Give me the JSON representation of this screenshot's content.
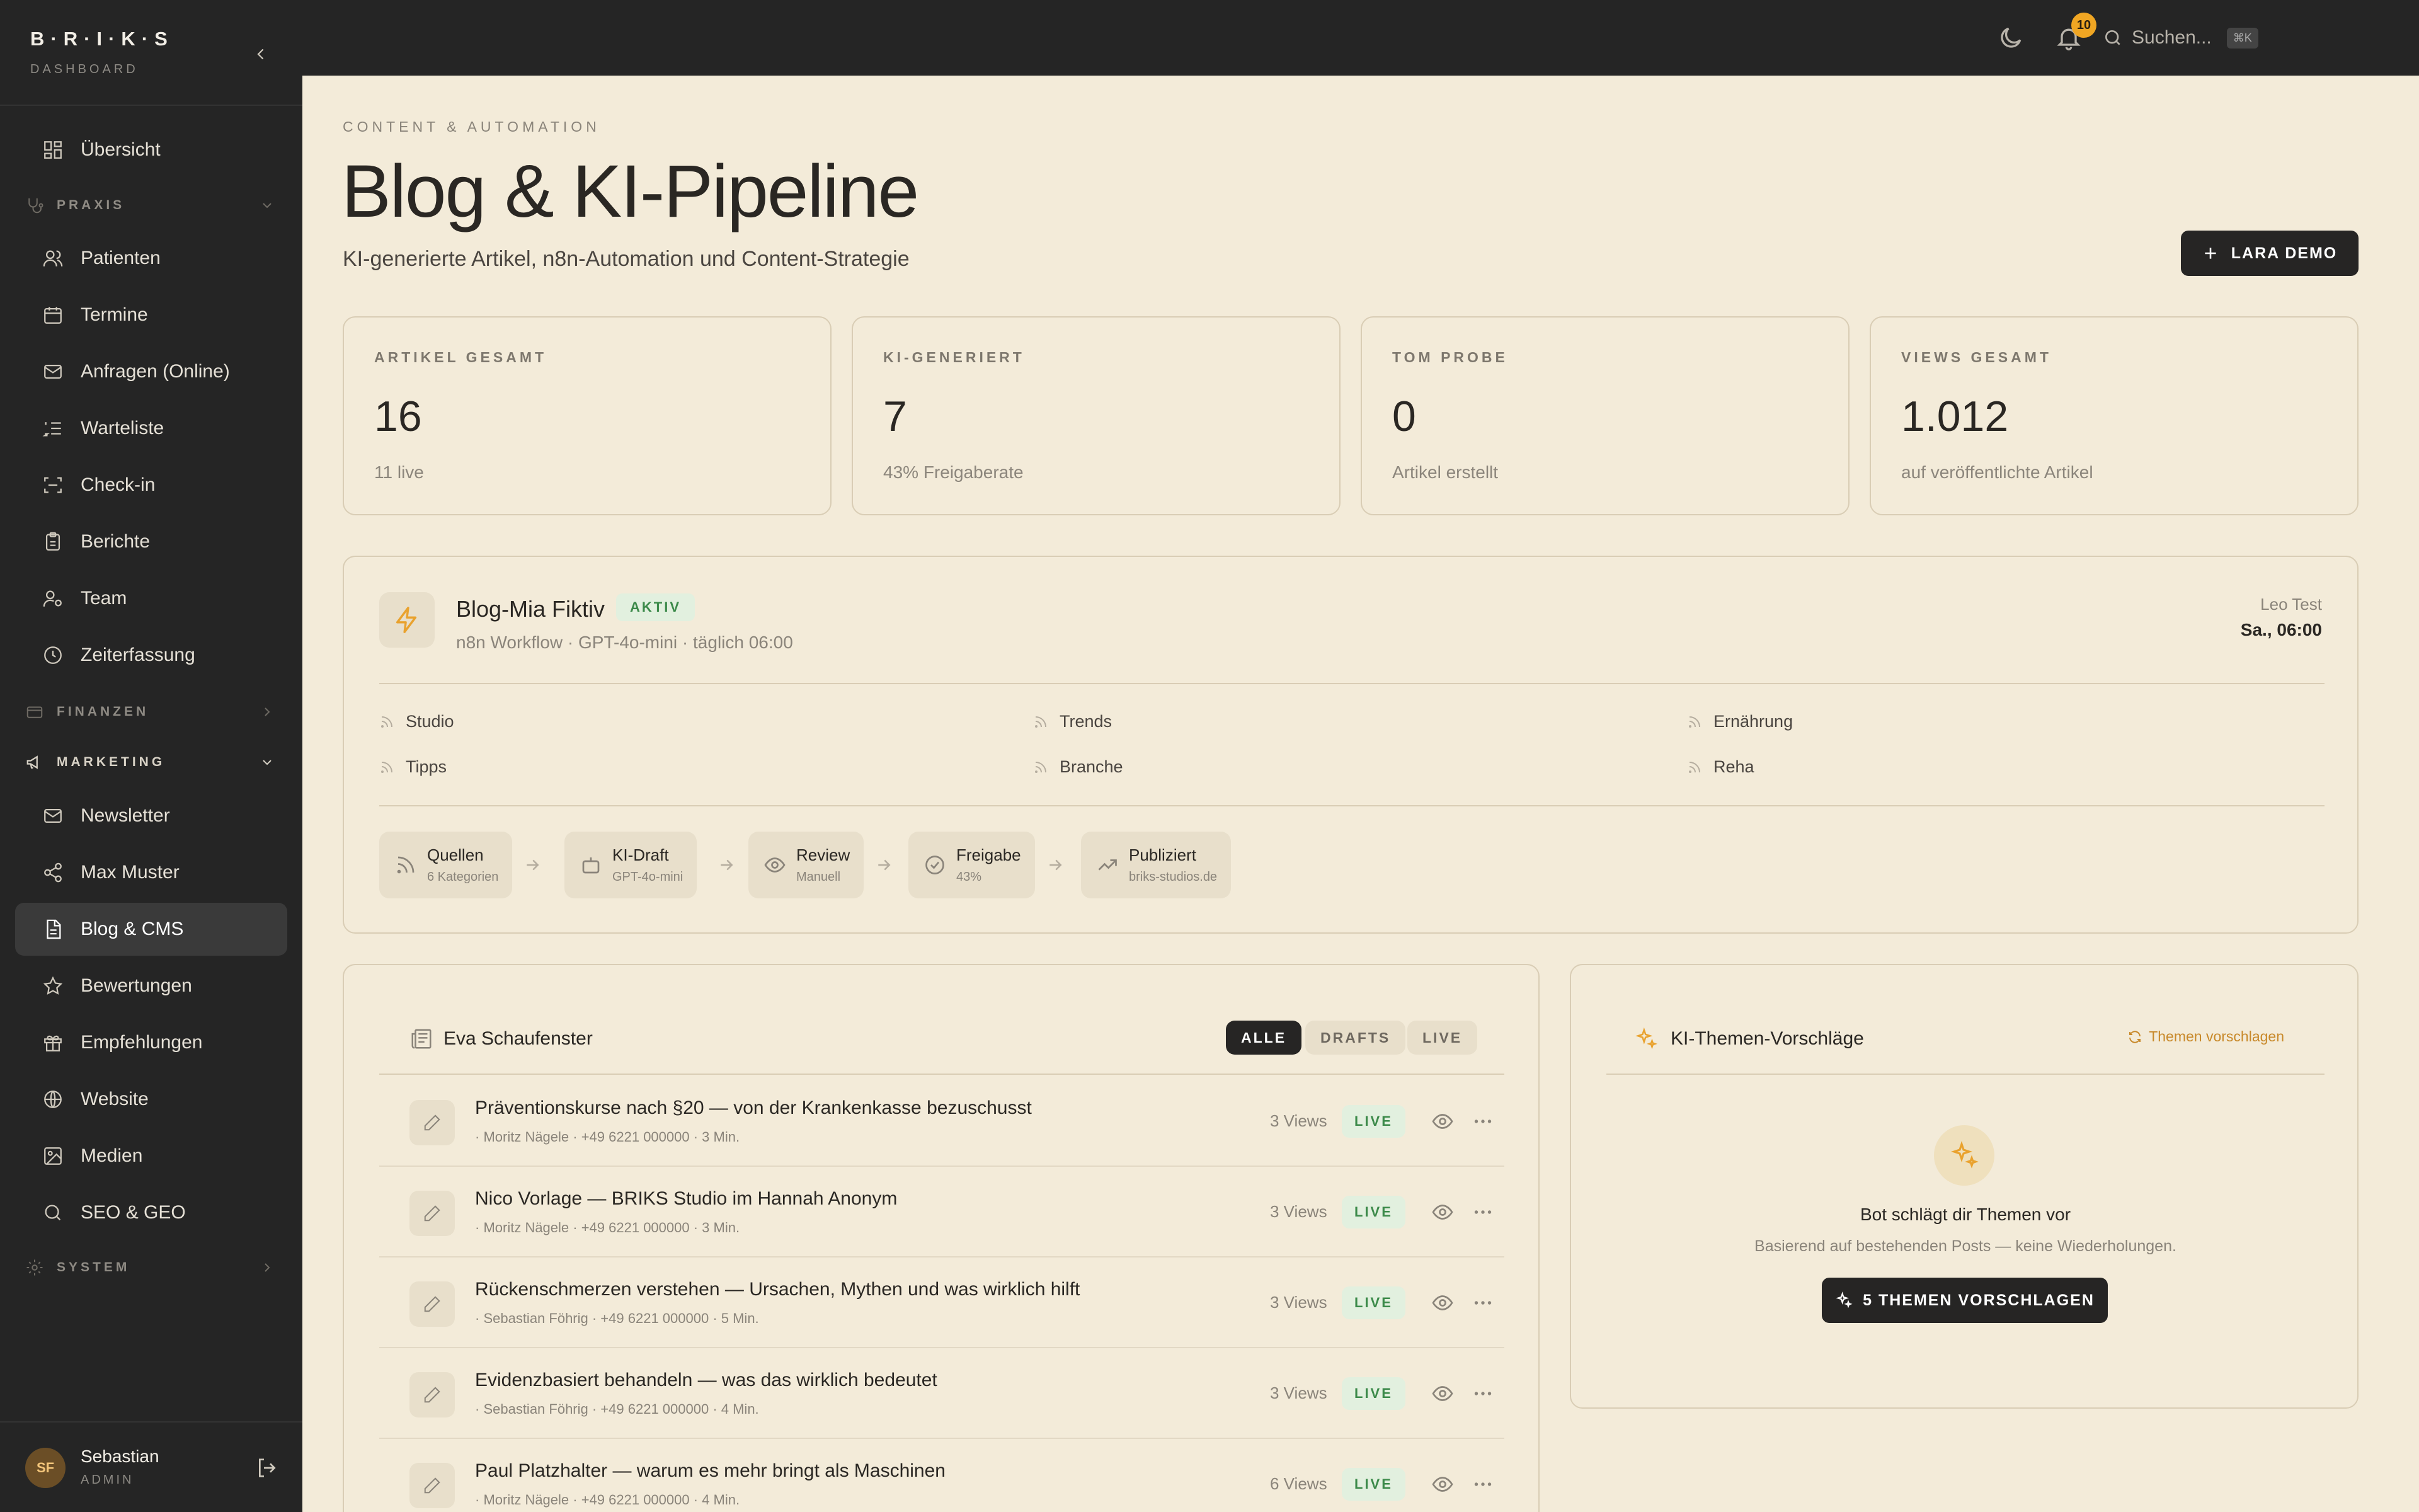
{
  "app": {
    "logo": "B·R·I·K·S",
    "logo_sub": "DASHBOARD"
  },
  "sidebar": {
    "items": [
      {
        "label": "Übersicht",
        "icon": "grid-icon"
      },
      {
        "label": "Patienten",
        "icon": "users-icon"
      },
      {
        "label": "Termine",
        "icon": "calendar-icon"
      },
      {
        "label": "Anfragen (Online)",
        "icon": "mail-icon"
      },
      {
        "label": "Warteliste",
        "icon": "list-ordered-icon"
      },
      {
        "label": "Check-in",
        "icon": "scan-icon"
      },
      {
        "label": "Berichte",
        "icon": "clipboard-icon"
      },
      {
        "label": "Team",
        "icon": "user-group-icon"
      },
      {
        "label": "Zeiterfassung",
        "icon": "clock-icon"
      },
      {
        "label": "Newsletter",
        "icon": "mail-icon"
      },
      {
        "label": "Max Muster",
        "icon": "share-icon"
      },
      {
        "label": "Blog & CMS",
        "icon": "document-icon"
      },
      {
        "label": "Bewertungen",
        "icon": "star-icon"
      },
      {
        "label": "Empfehlungen",
        "icon": "gift-icon"
      },
      {
        "label": "Website",
        "icon": "globe-icon"
      },
      {
        "label": "Medien",
        "icon": "image-icon"
      },
      {
        "label": "SEO & GEO",
        "icon": "search-icon"
      }
    ],
    "sections": {
      "praxis": "PRAXIS",
      "finanzen": "FINANZEN",
      "marketing": "MARKETING",
      "system": "SYSTEM"
    },
    "active": "Blog & CMS"
  },
  "user": {
    "initials": "SF",
    "name": "Sebastian",
    "role": "ADMIN"
  },
  "topbar": {
    "search_placeholder": "Suchen...",
    "shortcut": "⌘K",
    "notifications": "10"
  },
  "page": {
    "eyebrow": "CONTENT & AUTOMATION",
    "title": "Blog & KI-Pipeline",
    "subtitle": "KI-generierte Artikel, n8n-Automation und Content-Strategie",
    "demo_button": "LARA DEMO"
  },
  "stats": [
    {
      "label": "ARTIKEL GESAMT",
      "value": "16",
      "sub": "11 live"
    },
    {
      "label": "KI-GENERIERT",
      "value": "7",
      "sub": "43% Freigaberate"
    },
    {
      "label": "TOM PROBE",
      "value": "0",
      "sub": "Artikel erstellt"
    },
    {
      "label": "VIEWS GESAMT",
      "value": "1.012",
      "sub": "auf veröffentlichte Artikel"
    }
  ],
  "workflow": {
    "title": "Blog-Mia Fiktiv",
    "status": "AKTIV",
    "meta": "n8n Workflow · GPT-4o-mini · täglich 06:00",
    "next_label": "Leo Test",
    "next_time": "Sa., 06:00",
    "feeds": [
      "Studio",
      "Trends",
      "Ernährung",
      "Tipps",
      "Branche",
      "Reha"
    ],
    "steps": [
      {
        "title": "Quellen",
        "sub": "6 Kategorien",
        "icon": "rss-icon"
      },
      {
        "title": "KI-Draft",
        "sub": "GPT-4o-mini",
        "icon": "bot-icon"
      },
      {
        "title": "Review",
        "sub": "Manuell",
        "icon": "eye-icon"
      },
      {
        "title": "Freigabe",
        "sub": "43%",
        "icon": "check-circle-icon"
      },
      {
        "title": "Publiziert",
        "sub": "briks-studios.de",
        "icon": "trending-up-icon"
      }
    ]
  },
  "blog": {
    "title": "Eva Schaufenster",
    "filters": [
      "ALLE",
      "DRAFTS",
      "LIVE"
    ],
    "posts": [
      {
        "title": "Präventionskurse nach §20 — von der Krankenkasse bezuschusst",
        "meta": "· Moritz Nägele · +49 6221 000000 · 3 Min.",
        "views": "3 Views",
        "status": "LIVE"
      },
      {
        "title": "Nico Vorlage — BRIKS Studio im Hannah Anonym",
        "meta": "· Moritz Nägele · +49 6221 000000 · 3 Min.",
        "views": "3 Views",
        "status": "LIVE"
      },
      {
        "title": "Rückenschmerzen verstehen — Ursachen, Mythen und was wirklich hilft",
        "meta": "· Sebastian Föhrig · +49 6221 000000 · 5 Min.",
        "views": "3 Views",
        "status": "LIVE"
      },
      {
        "title": "Evidenzbasiert behandeln — was das wirklich bedeutet",
        "meta": "· Sebastian Föhrig · +49 6221 000000 · 4 Min.",
        "views": "3 Views",
        "status": "LIVE"
      },
      {
        "title": "Paul Platzhalter — warum es mehr bringt als Maschinen",
        "meta": "· Moritz Nägele · +49 6221 000000 · 4 Min.",
        "views": "6 Views",
        "status": "LIVE"
      }
    ]
  },
  "ki": {
    "title": "KI-Themen-Vorschläge",
    "link": "Themen vorschlagen",
    "heading": "Bot schlägt dir Themen vor",
    "text": "Basierend auf bestehenden Posts — keine Wiederholungen.",
    "button": "5 THEMEN VORSCHLAGEN"
  },
  "colors": {
    "sidebar": "#252525",
    "background": "#f3ebd9",
    "accent": "#f0a623",
    "live_bg": "#e2f0df",
    "live_text": "#3c8a4a"
  }
}
